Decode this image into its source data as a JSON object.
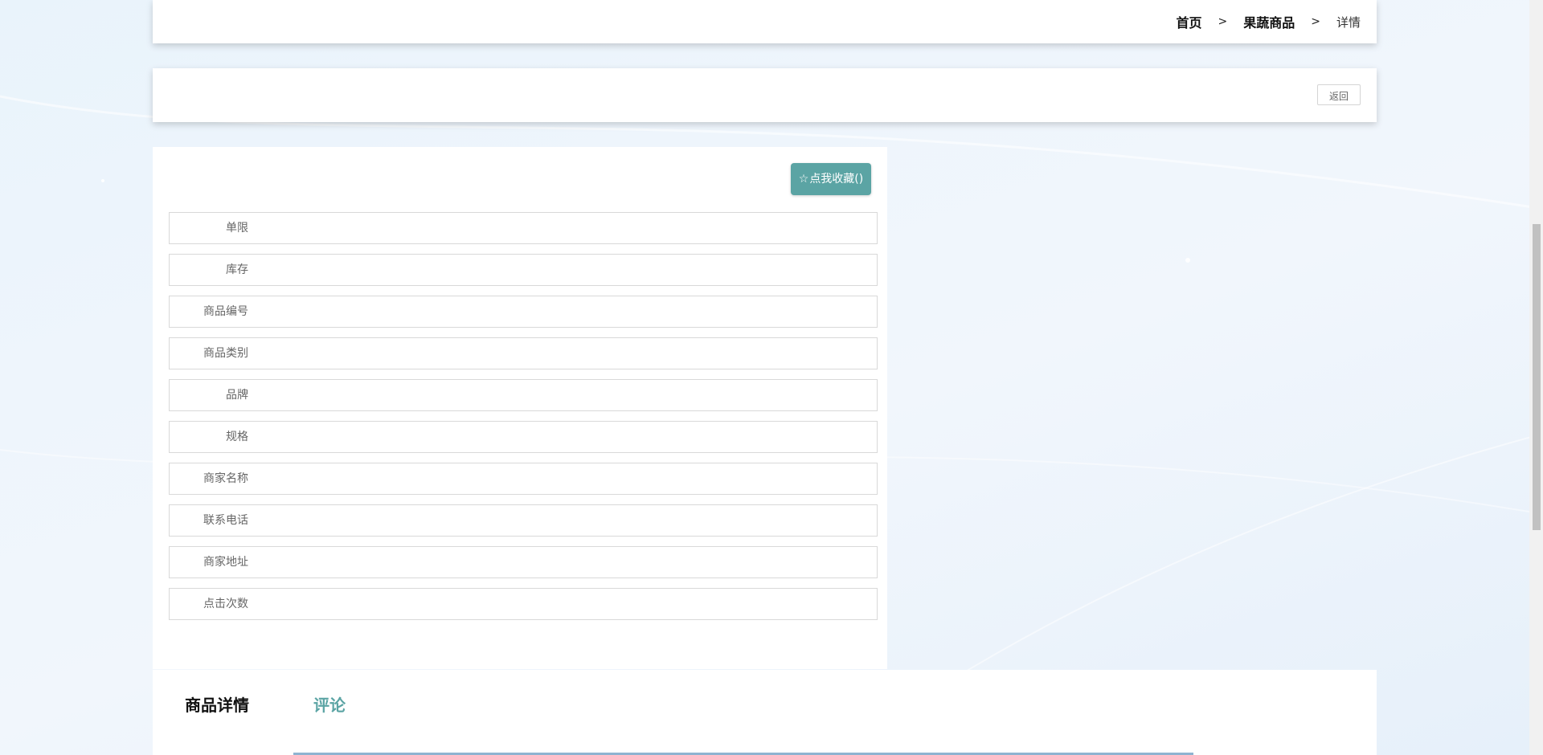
{
  "breadcrumb": {
    "home": "首页",
    "category": "果蔬商品",
    "current": "详情",
    "separator": ">"
  },
  "actions": {
    "back_label": "返回"
  },
  "favorite": {
    "star_icon": "☆",
    "label": "点我收藏()"
  },
  "fields": [
    {
      "label": "单限",
      "value": ""
    },
    {
      "label": "库存",
      "value": ""
    },
    {
      "label": "商品编号",
      "value": ""
    },
    {
      "label": "商品类别",
      "value": ""
    },
    {
      "label": "品牌",
      "value": ""
    },
    {
      "label": "规格",
      "value": ""
    },
    {
      "label": "商家名称",
      "value": ""
    },
    {
      "label": "联系电话",
      "value": ""
    },
    {
      "label": "商家地址",
      "value": ""
    },
    {
      "label": "点击次数",
      "value": ""
    }
  ],
  "tabs": [
    {
      "label": "商品详情"
    },
    {
      "label": "评论"
    }
  ],
  "colors": {
    "accent": "#5ba4a4",
    "border": "#d9d9d9",
    "label_text": "#666666"
  }
}
